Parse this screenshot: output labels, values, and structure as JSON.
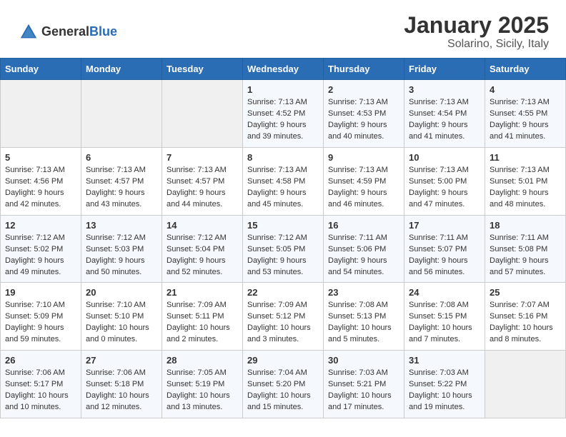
{
  "header": {
    "logo_general": "General",
    "logo_blue": "Blue",
    "title": "January 2025",
    "subtitle": "Solarino, Sicily, Italy"
  },
  "days_of_week": [
    "Sunday",
    "Monday",
    "Tuesday",
    "Wednesday",
    "Thursday",
    "Friday",
    "Saturday"
  ],
  "weeks": [
    [
      {
        "day": "",
        "info": ""
      },
      {
        "day": "",
        "info": ""
      },
      {
        "day": "",
        "info": ""
      },
      {
        "day": "1",
        "info": "Sunrise: 7:13 AM\nSunset: 4:52 PM\nDaylight: 9 hours\nand 39 minutes."
      },
      {
        "day": "2",
        "info": "Sunrise: 7:13 AM\nSunset: 4:53 PM\nDaylight: 9 hours\nand 40 minutes."
      },
      {
        "day": "3",
        "info": "Sunrise: 7:13 AM\nSunset: 4:54 PM\nDaylight: 9 hours\nand 41 minutes."
      },
      {
        "day": "4",
        "info": "Sunrise: 7:13 AM\nSunset: 4:55 PM\nDaylight: 9 hours\nand 41 minutes."
      }
    ],
    [
      {
        "day": "5",
        "info": "Sunrise: 7:13 AM\nSunset: 4:56 PM\nDaylight: 9 hours\nand 42 minutes."
      },
      {
        "day": "6",
        "info": "Sunrise: 7:13 AM\nSunset: 4:57 PM\nDaylight: 9 hours\nand 43 minutes."
      },
      {
        "day": "7",
        "info": "Sunrise: 7:13 AM\nSunset: 4:57 PM\nDaylight: 9 hours\nand 44 minutes."
      },
      {
        "day": "8",
        "info": "Sunrise: 7:13 AM\nSunset: 4:58 PM\nDaylight: 9 hours\nand 45 minutes."
      },
      {
        "day": "9",
        "info": "Sunrise: 7:13 AM\nSunset: 4:59 PM\nDaylight: 9 hours\nand 46 minutes."
      },
      {
        "day": "10",
        "info": "Sunrise: 7:13 AM\nSunset: 5:00 PM\nDaylight: 9 hours\nand 47 minutes."
      },
      {
        "day": "11",
        "info": "Sunrise: 7:13 AM\nSunset: 5:01 PM\nDaylight: 9 hours\nand 48 minutes."
      }
    ],
    [
      {
        "day": "12",
        "info": "Sunrise: 7:12 AM\nSunset: 5:02 PM\nDaylight: 9 hours\nand 49 minutes."
      },
      {
        "day": "13",
        "info": "Sunrise: 7:12 AM\nSunset: 5:03 PM\nDaylight: 9 hours\nand 50 minutes."
      },
      {
        "day": "14",
        "info": "Sunrise: 7:12 AM\nSunset: 5:04 PM\nDaylight: 9 hours\nand 52 minutes."
      },
      {
        "day": "15",
        "info": "Sunrise: 7:12 AM\nSunset: 5:05 PM\nDaylight: 9 hours\nand 53 minutes."
      },
      {
        "day": "16",
        "info": "Sunrise: 7:11 AM\nSunset: 5:06 PM\nDaylight: 9 hours\nand 54 minutes."
      },
      {
        "day": "17",
        "info": "Sunrise: 7:11 AM\nSunset: 5:07 PM\nDaylight: 9 hours\nand 56 minutes."
      },
      {
        "day": "18",
        "info": "Sunrise: 7:11 AM\nSunset: 5:08 PM\nDaylight: 9 hours\nand 57 minutes."
      }
    ],
    [
      {
        "day": "19",
        "info": "Sunrise: 7:10 AM\nSunset: 5:09 PM\nDaylight: 9 hours\nand 59 minutes."
      },
      {
        "day": "20",
        "info": "Sunrise: 7:10 AM\nSunset: 5:10 PM\nDaylight: 10 hours\nand 0 minutes."
      },
      {
        "day": "21",
        "info": "Sunrise: 7:09 AM\nSunset: 5:11 PM\nDaylight: 10 hours\nand 2 minutes."
      },
      {
        "day": "22",
        "info": "Sunrise: 7:09 AM\nSunset: 5:12 PM\nDaylight: 10 hours\nand 3 minutes."
      },
      {
        "day": "23",
        "info": "Sunrise: 7:08 AM\nSunset: 5:13 PM\nDaylight: 10 hours\nand 5 minutes."
      },
      {
        "day": "24",
        "info": "Sunrise: 7:08 AM\nSunset: 5:15 PM\nDaylight: 10 hours\nand 7 minutes."
      },
      {
        "day": "25",
        "info": "Sunrise: 7:07 AM\nSunset: 5:16 PM\nDaylight: 10 hours\nand 8 minutes."
      }
    ],
    [
      {
        "day": "26",
        "info": "Sunrise: 7:06 AM\nSunset: 5:17 PM\nDaylight: 10 hours\nand 10 minutes."
      },
      {
        "day": "27",
        "info": "Sunrise: 7:06 AM\nSunset: 5:18 PM\nDaylight: 10 hours\nand 12 minutes."
      },
      {
        "day": "28",
        "info": "Sunrise: 7:05 AM\nSunset: 5:19 PM\nDaylight: 10 hours\nand 13 minutes."
      },
      {
        "day": "29",
        "info": "Sunrise: 7:04 AM\nSunset: 5:20 PM\nDaylight: 10 hours\nand 15 minutes."
      },
      {
        "day": "30",
        "info": "Sunrise: 7:03 AM\nSunset: 5:21 PM\nDaylight: 10 hours\nand 17 minutes."
      },
      {
        "day": "31",
        "info": "Sunrise: 7:03 AM\nSunset: 5:22 PM\nDaylight: 10 hours\nand 19 minutes."
      },
      {
        "day": "",
        "info": ""
      }
    ]
  ]
}
